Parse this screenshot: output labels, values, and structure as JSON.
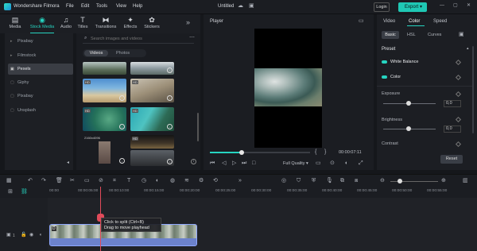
{
  "app": {
    "name": "Wondershare Filmora",
    "title": "Untitled",
    "menu": [
      "File",
      "Edit",
      "Tools",
      "View",
      "Help"
    ],
    "login": "Login",
    "export": "Export"
  },
  "tools": [
    {
      "label": "Media",
      "icon": "media-icon"
    },
    {
      "label": "Stock Media",
      "icon": "stock-media-icon"
    },
    {
      "label": "Audio",
      "icon": "audio-icon"
    },
    {
      "label": "Titles",
      "icon": "titles-icon"
    },
    {
      "label": "Transitions",
      "icon": "transitions-icon"
    },
    {
      "label": "Effects",
      "icon": "effects-icon"
    },
    {
      "label": "Stickers",
      "icon": "stickers-icon"
    }
  ],
  "sidebar": {
    "items": [
      "Pixabay",
      "Filmstock",
      "Pexels",
      "Giphy",
      "Pixabay",
      "Unsplash"
    ],
    "selected": "Pexels"
  },
  "media": {
    "search_placeholder": "Search images and videos",
    "tabs": [
      "Videos",
      "Photos"
    ],
    "active_tab": "Videos",
    "duration_label": "2160x4096"
  },
  "player": {
    "label": "Player",
    "timecode": "00:00:07:11",
    "quality": "Full Quality",
    "progress": 0.32
  },
  "props": {
    "tabs": [
      "Video",
      "Color",
      "Speed"
    ],
    "active_tab": "Color",
    "subtabs": [
      "Basic",
      "HSL",
      "Curves"
    ],
    "active_subtab": "Basic",
    "preset": "Preset",
    "white_balance": "White Balance",
    "color": "Color",
    "exposure": "Exposure",
    "exposure_val": "0,0",
    "brightness": "Brightness",
    "brightness_val": "0,0",
    "contrast": "Contrast",
    "reset": "Reset"
  },
  "timeline": {
    "ticks": [
      "00:00",
      "00:00:05:00",
      "00:00:10:00",
      "00:00:15:00",
      "00:00:20:00",
      "00:00:25:00",
      "00:00:30:00",
      "00:00:35:00",
      "00:00:40:00",
      "00:00:45:00",
      "00:00:50:00",
      "00:00:55:00"
    ],
    "track_label": "1",
    "tooltip_line1": "Click to split (Ctrl+B)",
    "tooltip_line2": "Drag to move playhead"
  }
}
